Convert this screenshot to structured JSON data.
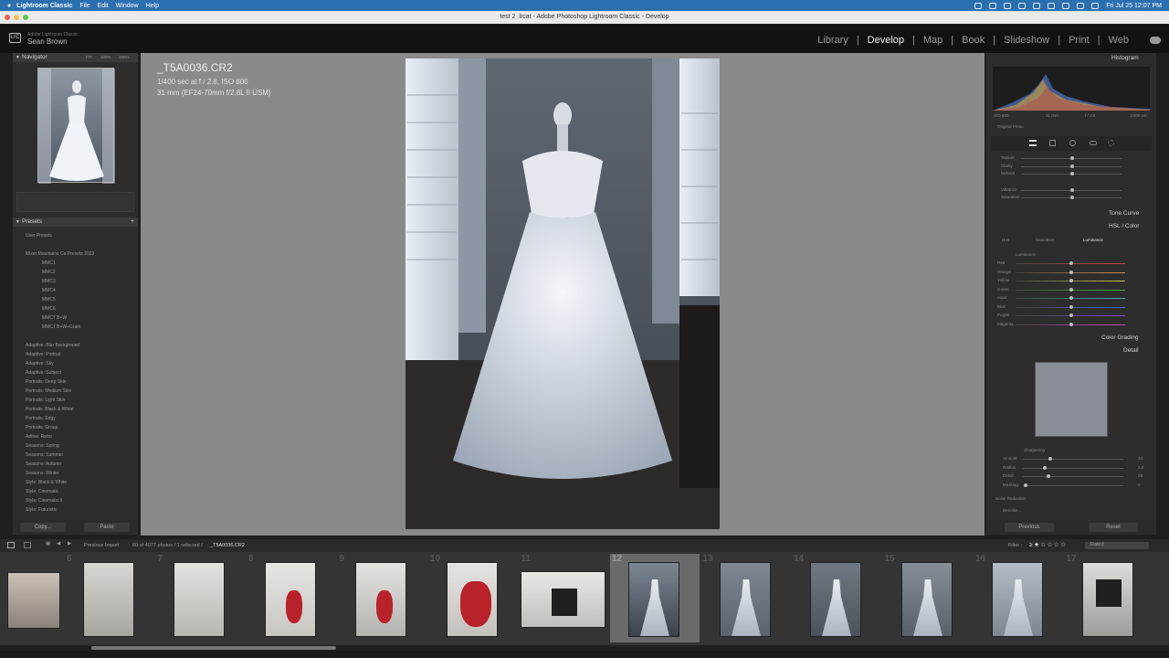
{
  "menubar": {
    "apple": "",
    "app": "Lightroom Classic",
    "items": [
      "File",
      "Edit",
      "Window",
      "Help"
    ],
    "clock": "Fri Jul 25  12:07 PM"
  },
  "titlebar": {
    "title": "test 2 .lrcat - Adobe Photoshop Lightroom Classic - Develop"
  },
  "identity": {
    "badge": "LrC",
    "product": "Adobe Lightroom Classic",
    "user": "Sean Brown"
  },
  "modules": [
    {
      "label": "Library"
    },
    {
      "label": "Develop",
      "active": true
    },
    {
      "label": "Map"
    },
    {
      "label": "Book"
    },
    {
      "label": "Slideshow"
    },
    {
      "label": "Print"
    },
    {
      "label": "Web"
    }
  ],
  "navigator": {
    "title": "Navigator",
    "zoom": [
      "FIT",
      "100%",
      "200%"
    ]
  },
  "presets": {
    "title": "Presets",
    "user_presets": "User Presets",
    "group": "Mixer Mountains Co Presets 2023",
    "mmc": [
      "MMC1",
      "MMC2",
      "MMC3",
      "MMC4",
      "MMC5",
      "MMC6",
      "MMC7 B+W",
      "MMC7 B+W+Grain"
    ],
    "others": [
      "Adaptive: Blur Background",
      "Adaptive: Portrait",
      "Adaptive: Sky",
      "Adaptive: Subject",
      "Portraits: Deep Skin",
      "Portraits: Medium Skin",
      "Portraits: Light Skin",
      "Portraits: Black & White",
      "Portraits: Edgy",
      "Portraits: Group",
      "Adtive: Retro",
      "Seasons: Spring",
      "Seasons: Summer",
      "Seasons: Autumn",
      "Seasons: Winter",
      "Style: Black & White",
      "Style: Cinematic",
      "Style: Cinematic II",
      "Style: Futuristic"
    ]
  },
  "left_buttons": {
    "copy": "Copy...",
    "paste": "Paste"
  },
  "photo_info": {
    "filename": "_T5A0036.CR2",
    "line1": "1/400 sec at f / 2.8, ISO 800",
    "line2": "31 mm (EF24-70mm f/2.8L II USM)"
  },
  "histogram": {
    "title": "Histogram",
    "readouts": [
      "ISO 800",
      "31 mm",
      "f / 2.8",
      "1/400 sec"
    ],
    "original": "Original Photo"
  },
  "basic_sliders": [
    "Texture",
    "Clarity",
    "Dehaze",
    "Vibrance",
    "Saturation"
  ],
  "panels": {
    "tone_curve": "Tone Curve",
    "hsl": "HSL / Color",
    "color_grading": "Color Grading",
    "detail": "Detail"
  },
  "hsl_tabs": [
    "Hue",
    "Saturation",
    "Luminance"
  ],
  "hsl_active": "Luminance",
  "hsl_section": "Luminance",
  "hsl_colors": [
    "Red",
    "Orange",
    "Yellow",
    "Green",
    "Aqua",
    "Blue",
    "Purple",
    "Magenta"
  ],
  "sharpening": {
    "title": "Sharpening",
    "sliders": [
      "Amount",
      "Radius",
      "Detail",
      "Masking"
    ],
    "values": [
      "40",
      "1.0",
      "25",
      "0"
    ]
  },
  "noise": {
    "title": "Noise Reduction",
    "denoise": "Denoise..."
  },
  "right_buttons": {
    "previous": "Previous",
    "reset": "Reset"
  },
  "filmstrip_bar": {
    "source": "Previous Import",
    "count": "60 of 4077 photos / 1 selected /",
    "file": "_T5A0036.CR2",
    "filter_label": "Filter :",
    "rated": "Rated"
  },
  "filmstrip": {
    "numbers": [
      "6",
      "7",
      "8",
      "9",
      "10",
      "11",
      "12",
      "13",
      "14",
      "15",
      "16",
      "17"
    ],
    "selected": "12"
  },
  "colors": {
    "accent": "#2a6fb0",
    "panel": "#2d2d2d",
    "center_bg": "#8a8a8a",
    "shoe_red": "#b8222a"
  }
}
